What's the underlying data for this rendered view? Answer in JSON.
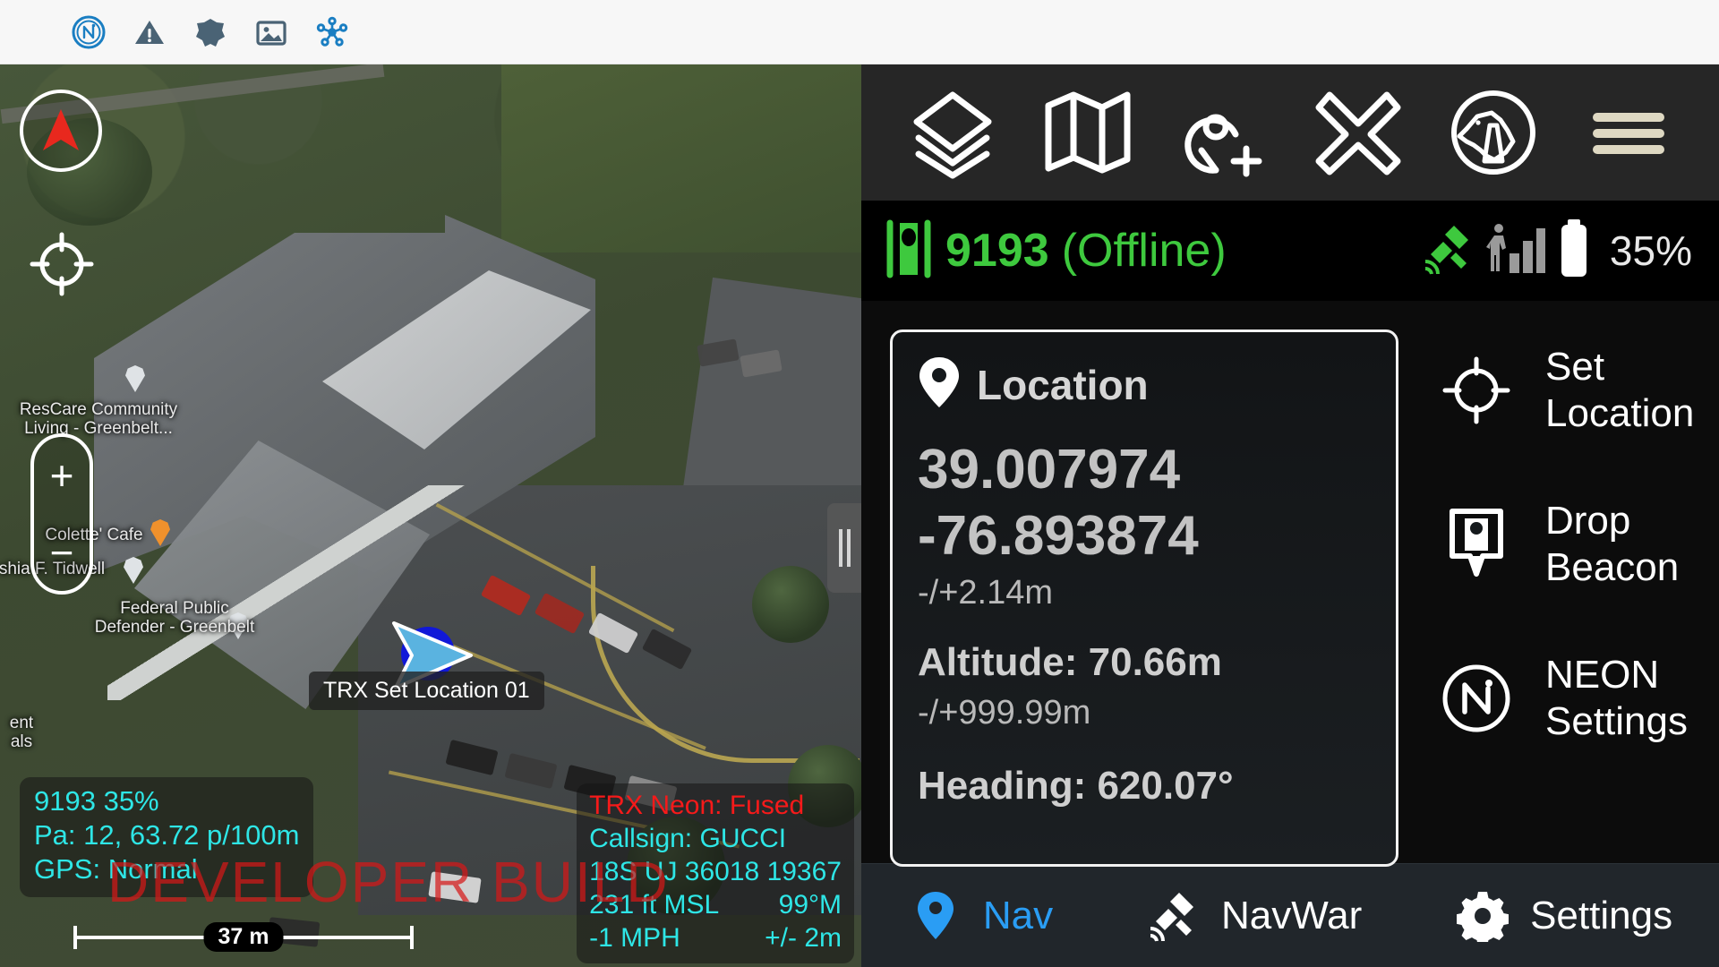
{
  "statusbar": {
    "icons": [
      {
        "name": "neon-app-icon",
        "label": "NEON"
      },
      {
        "name": "warning-triangle-icon",
        "label": "Warning"
      },
      {
        "name": "badge-alert-icon",
        "label": "Alert"
      },
      {
        "name": "image-icon",
        "label": "Screenshot"
      },
      {
        "name": "network-nodes-icon",
        "label": "Network"
      }
    ]
  },
  "map": {
    "compass_control": "compass-needle",
    "locate_control": "crosshair",
    "zoom_in_label": "+",
    "zoom_out_label": "−",
    "marker_label": "TRX Set Location 01",
    "pois": [
      {
        "name": "rescare",
        "label": "ResCare Community\nLiving - Greenbelt..."
      },
      {
        "name": "colette-cafe",
        "label": "Colette' Cafe"
      },
      {
        "name": "tidwell",
        "label": "shia F. Tidwell"
      },
      {
        "name": "federal-public-defender",
        "label": "Federal Public\nDefender - Greenbelt"
      },
      {
        "name": "rentals",
        "label": "ent\nals"
      }
    ],
    "telemetry_left": [
      "9193 35%",
      "Pa: 12, 63.72 p/100m",
      "GPS: Normal"
    ],
    "telemetry_right": {
      "title": "TRX Neon: Fused",
      "callsign": "Callsign: GUCCI",
      "mgrs": "18S  UJ  36018  19367",
      "altitude": "231 ft MSL",
      "heading": "99°M",
      "speed": "-1 MPH",
      "accuracy": "+/- 2m"
    },
    "watermark": "DEVELOPER BUILD",
    "scale_label": "37 m"
  },
  "panel": {
    "toolbar": [
      {
        "name": "layers-button",
        "icon": "layers-icon",
        "label": "Layers"
      },
      {
        "name": "map-button",
        "icon": "map-icon",
        "label": "Map"
      },
      {
        "name": "add-waypoint-button",
        "icon": "pin-plus-icon",
        "label": "Add Waypoint"
      },
      {
        "name": "close-button",
        "icon": "x-icon",
        "label": "Close"
      },
      {
        "name": "k9-button",
        "icon": "dog-icon",
        "label": "K9"
      },
      {
        "name": "menu-button",
        "icon": "hamburger-icon",
        "label": "Menu"
      }
    ],
    "device": {
      "callsign": "9193",
      "status": "(Offline)",
      "battery_percent": "35%",
      "icons": [
        "beacon-icon",
        "satellite-icon",
        "pedestrian-signal-icon",
        "battery-icon"
      ]
    },
    "location_card": {
      "title": "Location",
      "icon": "location-pin-icon",
      "latitude": "39.007974",
      "longitude": "-76.893874",
      "horizontal_accuracy": "-/+2.14m",
      "altitude": "Altitude: 70.66m",
      "altitude_accuracy": "-/+999.99m",
      "heading": "Heading:  620.07°"
    },
    "actions": [
      {
        "name": "set-location-button",
        "icon": "crosshair-icon",
        "label": "Set\nLocation"
      },
      {
        "name": "drop-beacon-button",
        "icon": "beacon-pin-icon",
        "label": "Drop\nBeacon"
      },
      {
        "name": "neon-settings-button",
        "icon": "neon-icon",
        "label": "NEON\nSettings"
      }
    ],
    "bottom_nav": [
      {
        "name": "nav-tab",
        "icon": "location-pin-icon",
        "label": "Nav",
        "active": true
      },
      {
        "name": "navwar-tab",
        "icon": "satellite-icon",
        "label": "NavWar",
        "active": false
      },
      {
        "name": "settings-tab",
        "icon": "gear-icon",
        "label": "Settings",
        "active": false
      }
    ]
  },
  "colors": {
    "accent_blue": "#2a9df4",
    "status_green": "#3ec93e",
    "telemetry_cyan": "#2ee6e6",
    "alert_red": "#f61a1a",
    "panel_bg": "#0c0c0c",
    "toolbar_bg": "#262626",
    "nav_bg": "#21262b"
  }
}
